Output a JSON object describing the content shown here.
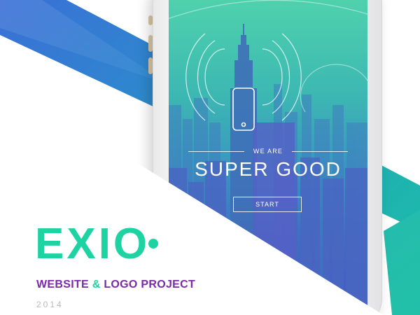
{
  "colors": {
    "brand_green": "#1ed3a2",
    "brand_purple": "#7a2aa8",
    "band_blue": "#3a6fd6",
    "band_teal": "#1bbfa8",
    "year_gray": "#b9b9b9"
  },
  "app_screen": {
    "eyebrow": "WE ARE",
    "headline": "SUPER GOOD",
    "start_label": "START",
    "illustration": "skyscraper-with-phone-signal-icon"
  },
  "brand": {
    "logo_text": "EXIO",
    "tagline_part1": "WEBSITE",
    "tagline_amp": "&",
    "tagline_part2": "LOGO PROJECT",
    "year": "2014"
  }
}
